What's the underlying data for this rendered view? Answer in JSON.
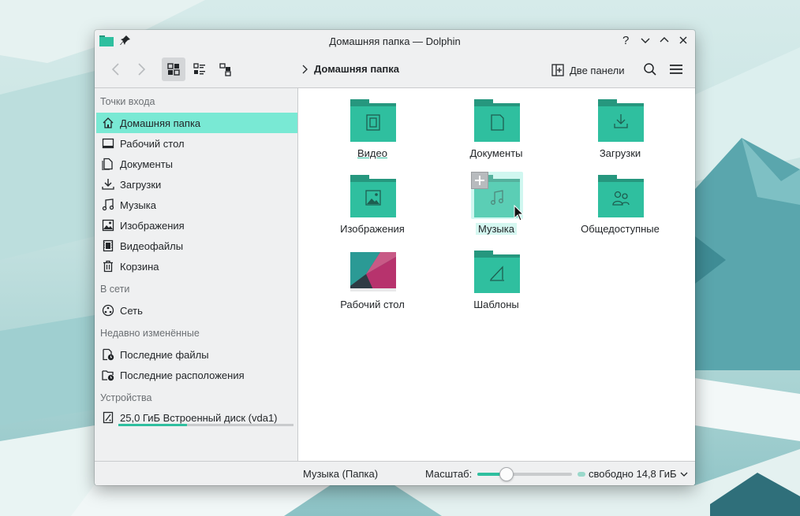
{
  "window": {
    "title": "Домашняя папка — Dolphin"
  },
  "toolbar": {
    "breadcrumb": "Домашняя папка",
    "split_label": "Две панели"
  },
  "sidebar": {
    "sections": [
      {
        "title": "Точки входа",
        "items": [
          {
            "label": "Домашняя папка",
            "icon": "home-icon"
          },
          {
            "label": "Рабочий стол",
            "icon": "desktop-icon"
          },
          {
            "label": "Документы",
            "icon": "documents-icon"
          },
          {
            "label": "Загрузки",
            "icon": "download-icon"
          },
          {
            "label": "Музыка",
            "icon": "music-icon"
          },
          {
            "label": "Изображения",
            "icon": "image-icon"
          },
          {
            "label": "Видеофайлы",
            "icon": "video-icon"
          },
          {
            "label": "Корзина",
            "icon": "trash-icon"
          }
        ]
      },
      {
        "title": "В сети",
        "items": [
          {
            "label": "Сеть",
            "icon": "network-icon"
          }
        ]
      },
      {
        "title": "Недавно изменённые",
        "items": [
          {
            "label": "Последние файлы",
            "icon": "recent-files-icon"
          },
          {
            "label": "Последние расположения",
            "icon": "recent-locations-icon"
          }
        ]
      },
      {
        "title": "Устройства",
        "items": [
          {
            "label": "25,0 ГиБ Встроенный диск (vda1)",
            "icon": "disk-icon"
          }
        ]
      }
    ],
    "disk_usage_fraction": 0.39
  },
  "content": {
    "items": [
      {
        "label": "Видео",
        "icon": "video-folder-icon"
      },
      {
        "label": "Документы",
        "icon": "documents-folder-icon"
      },
      {
        "label": "Загрузки",
        "icon": "downloads-folder-icon"
      },
      {
        "label": "Изображения",
        "icon": "pictures-folder-icon"
      },
      {
        "label": "Музыка",
        "icon": "music-folder-icon"
      },
      {
        "label": "Общедоступные",
        "icon": "public-folder-icon"
      },
      {
        "label": "Рабочий стол",
        "icon": "desktop-thumbnail-icon"
      },
      {
        "label": "Шаблоны",
        "icon": "templates-folder-icon"
      }
    ]
  },
  "statusbar": {
    "selection": "Музыка (Папка)",
    "zoom_label": "Масштаб:",
    "zoom_fraction": 0.3,
    "free_space": "свободно 14,8 ГиБ"
  },
  "colors": {
    "folder_body": "#2fbf9f",
    "folder_tab": "#26977e",
    "selection": "#79e9d4"
  }
}
